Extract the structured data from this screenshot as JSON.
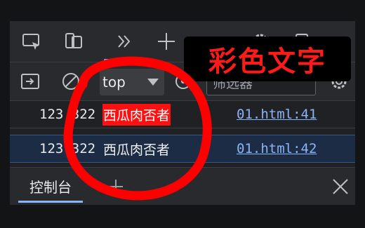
{
  "toolbar": {
    "icons": [
      "inspect-element-icon",
      "device-toolbar-icon",
      "more-panels-icon",
      "add-panel-icon",
      "settings-icon",
      "feedback-icon",
      "more-options-icon"
    ]
  },
  "console_toolbar": {
    "context_value": "top",
    "filter_placeholder": "筛选器"
  },
  "logs": [
    {
      "prefix": "123.322",
      "text": "西瓜肉否者",
      "link": "01.html:41",
      "style": "red-background"
    },
    {
      "prefix": "123.322",
      "text": "西瓜肉否者",
      "link": "01.html:42",
      "style": "plain"
    }
  ],
  "drawer": {
    "tab_label": "控制台"
  },
  "overlay": {
    "title": "彩色文字"
  },
  "colors": {
    "accent": "#8ab4f8",
    "highlight": "#ff1010",
    "annotation": "#ff0000"
  }
}
